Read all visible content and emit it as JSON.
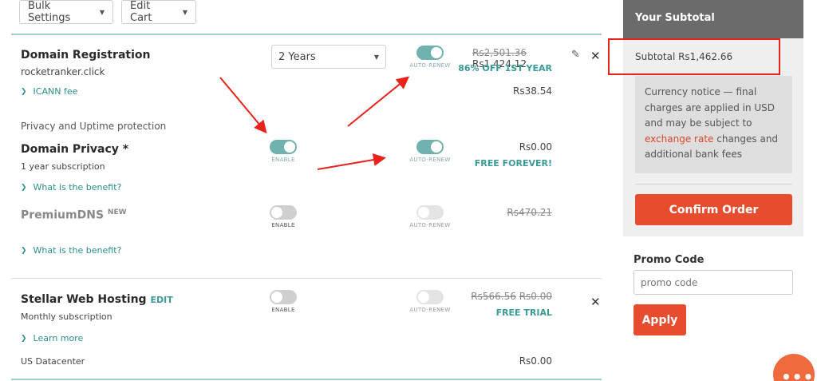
{
  "toolbar": {
    "bulk_settings": "Bulk Settings",
    "edit_cart": "Edit Cart"
  },
  "domain": {
    "title": "Domain Registration",
    "name": "rocketranker.click",
    "term": "2 Years",
    "autorenew_label": "AUTO-RENEW",
    "price_old": "Rs2,501.36",
    "price_new": "Rs1,424.12",
    "discount": "86% OFF 1ST YEAR",
    "icann_label": "ICANN fee",
    "icann_price": "Rs38.54"
  },
  "privacy_section": {
    "heading": "Privacy and Uptime protection"
  },
  "privacy": {
    "title": "Domain Privacy *",
    "sub": "1 year subscription",
    "benefit": "What is the benefit?",
    "enable_label": "ENABLE",
    "autorenew_label": "AUTO-RENEW",
    "price": "Rs0.00",
    "promo": "FREE FOREVER!"
  },
  "premiumdns": {
    "title": "PremiumDNS",
    "badge": "NEW",
    "benefit": "What is the benefit?",
    "enable_label": "ENABLE",
    "autorenew_label": "AUTO-RENEW",
    "price": "Rs470.21"
  },
  "hosting": {
    "title": "Stellar Web Hosting",
    "edit": "EDIT",
    "sub": "Monthly subscription",
    "learn": "Learn more",
    "enable_label": "ENABLE",
    "autorenew_label": "AUTO-RENEW",
    "price_old": "Rs566.56",
    "price_new": "Rs0.00",
    "promo": "FREE TRIAL",
    "datacenter": "US Datacenter",
    "datacenter_price": "Rs0.00"
  },
  "sidebar": {
    "heading": "Your Subtotal",
    "subtotal": "Subtotal Rs1,462.66",
    "notice_pre": "Currency notice — final charges are applied in USD and may be subject to ",
    "notice_link": "exchange rate",
    "notice_post": " changes and additional bank fees",
    "confirm": "Confirm Order",
    "promo_heading": "Promo Code",
    "promo_placeholder": "promo code",
    "apply": "Apply"
  },
  "colors": {
    "accent": "#e64c2d",
    "teal": "#6fb2ae",
    "annotation": "#e8231c"
  },
  "icons": {
    "caret": "caret-down-icon",
    "chevron": "chevron-down-icon",
    "close": "close-icon",
    "edit": "pencil-icon",
    "chat": "chat-icon"
  }
}
